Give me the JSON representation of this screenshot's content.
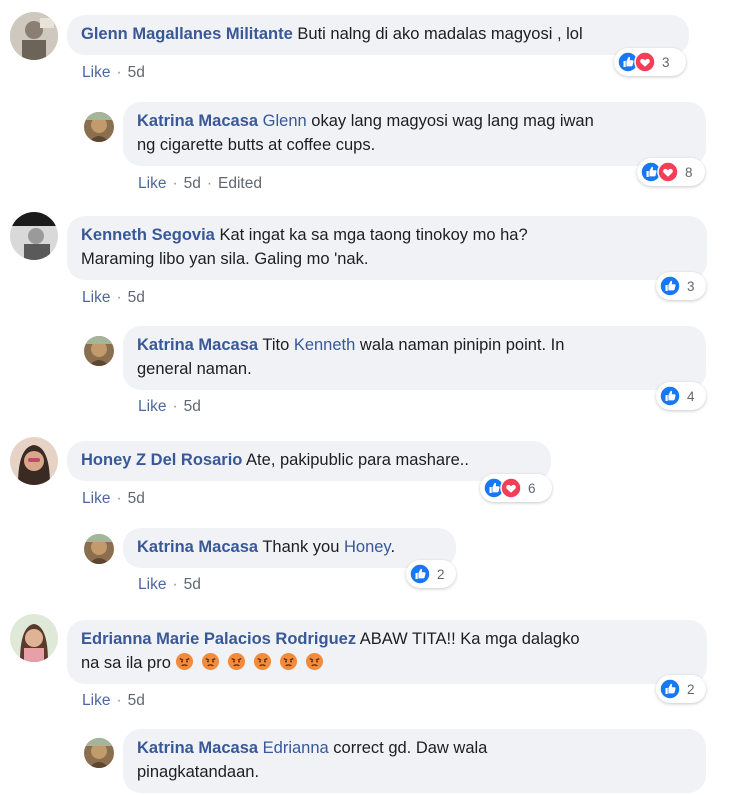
{
  "comments": [
    {
      "author": "Glenn Magallanes Militante",
      "text": " Buti nalng di ako madalas magyosi , lol",
      "actions": {
        "like": "Like",
        "time": "5d"
      },
      "reactions": {
        "icons": [
          "like-icon",
          "love-icon"
        ],
        "count": "3"
      },
      "reply": {
        "author": "Katrina Macasa",
        "mention": "Glenn",
        "line1": " okay lang magyosi wag lang mag iwan",
        "line2": "ng cigarette butts at coffee cups.",
        "actions": {
          "like": "Like",
          "time": "5d",
          "edited": "Edited"
        },
        "reactions": {
          "icons": [
            "like-icon",
            "love-icon"
          ],
          "count": "8"
        }
      }
    },
    {
      "author": "Kenneth Segovia",
      "line1": " Kat ingat ka sa mga taong tinokoy mo ha?",
      "line2": "Maraming libo yan sila. Galing mo 'nak.",
      "actions": {
        "like": "Like",
        "time": "5d"
      },
      "reactions": {
        "icons": [
          "like-icon"
        ],
        "count": "3"
      },
      "reply": {
        "author": "Katrina Macasa",
        "pre": " Tito ",
        "mention": "Kenneth",
        "line1": " wala naman pinipin point. In",
        "line2": "general naman.",
        "actions": {
          "like": "Like",
          "time": "5d"
        },
        "reactions": {
          "icons": [
            "like-icon"
          ],
          "count": "4"
        }
      }
    },
    {
      "author": "Honey Z Del Rosario",
      "text": " Ate, pakipublic para mashare..",
      "actions": {
        "like": "Like",
        "time": "5d"
      },
      "reactions": {
        "icons": [
          "like-icon",
          "love-icon"
        ],
        "count": "6"
      },
      "reply": {
        "author": "Katrina Macasa",
        "pre": " Thank you ",
        "mention": "Honey",
        "post": ".",
        "actions": {
          "like": "Like",
          "time": "5d"
        },
        "reactions": {
          "icons": [
            "like-icon"
          ],
          "count": "2"
        }
      }
    },
    {
      "author": "Edrianna Marie Palacios Rodriguez",
      "line1": " ABAW TITA!! Ka mga dalagko",
      "line2": "na sa ila pro ",
      "emojis": [
        "angry-face",
        "angry-face",
        "angry-face",
        "angry-face",
        "angry-face",
        "angry-face"
      ],
      "actions": {
        "like": "Like",
        "time": "5d"
      },
      "reactions": {
        "icons": [
          "like-icon"
        ],
        "count": "2"
      },
      "reply": {
        "author": "Katrina Macasa",
        "mention": "Edrianna",
        "line1": " correct gd. Daw wala",
        "line2": "pinagkatandaan."
      }
    }
  ],
  "colors": {
    "like": "#1877f2",
    "love": "#f33e58",
    "author": "#385898",
    "bubble": "#f0f2f5"
  }
}
